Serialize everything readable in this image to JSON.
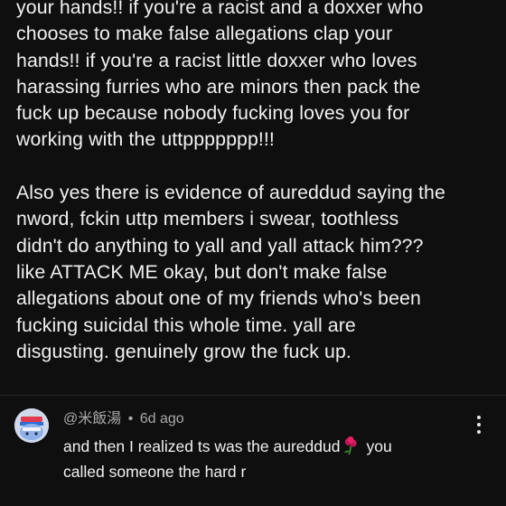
{
  "main_comment": {
    "lines_paragraph_1": [
      "your hands!! if you're a racist and a doxxer who",
      "chooses to make false allegations clap your",
      "hands!! if you're a racist little doxxer who loves",
      "harassing furries who are minors then pack the",
      "fuck up because nobody fucking loves you for",
      "working with the uttppppppp!!!"
    ],
    "lines_paragraph_2": [
      "Also yes there is evidence of aureddud saying the",
      "nword, fckin uttp members i swear, toothless",
      "didn't do anything to yall and yall attack him???",
      "like ATTACK ME okay, but don't make false",
      "allegations about one of my friends who's been",
      "fucking suicidal this whole time. yall are",
      "disgusting. genuinely grow the fuck up."
    ]
  },
  "reply": {
    "author": "@米飯湯",
    "separator": "•",
    "time": "6d ago",
    "text_line_1_before_emoji": "and then I realized ts was the aureddud",
    "emoji": "rose-icon",
    "text_line_1_after_emoji": "you",
    "text_line_2": "called someone the hard r",
    "avatar": "avatar-icon"
  },
  "colors": {
    "background": "#0f0f0f",
    "text_primary": "#f1f1f1",
    "text_secondary": "#aaaaaa",
    "divider": "#272727"
  }
}
